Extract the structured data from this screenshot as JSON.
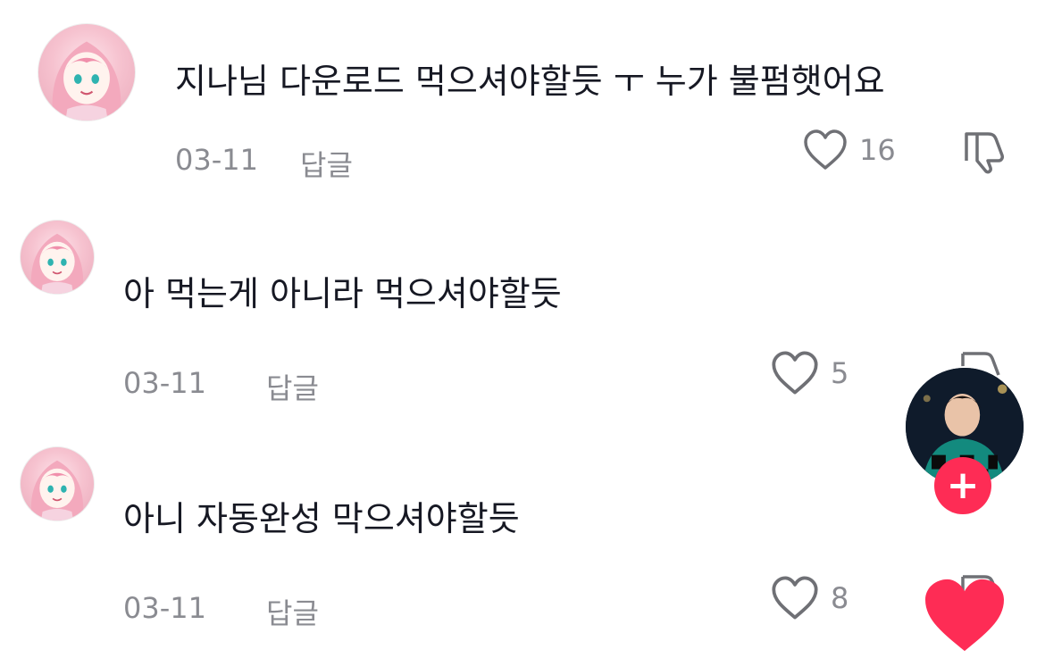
{
  "comments": [
    {
      "text": "지나님 다운로드 먹으셔야할듯 ㅜ 누가 불펌햇어요",
      "date": "03-11",
      "reply": "답글",
      "likes": "16"
    },
    {
      "text": "아 먹는게 아니라 먹으셔야할듯",
      "date": "03-11",
      "reply": "답글",
      "likes": "5"
    },
    {
      "text": "아니 자동완성 막으셔야할듯",
      "date": "03-11",
      "reply": "답글",
      "likes": "8"
    }
  ],
  "creator": {
    "follow_symbol": "+"
  },
  "icons": {
    "like": "heart-outline-icon",
    "dislike": "thumbs-down-icon",
    "follow": "plus-icon",
    "action_like": "heart-filled-icon"
  },
  "colors": {
    "accent": "#fe2c55",
    "meta": "#8a8b91",
    "text": "#161823"
  }
}
